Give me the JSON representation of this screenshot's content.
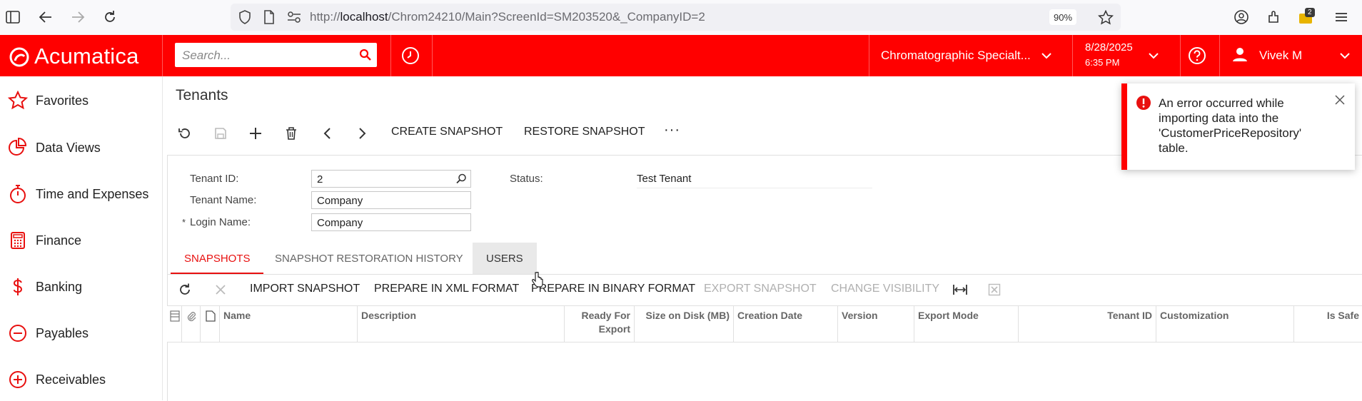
{
  "browser": {
    "url_prefix": "http://",
    "url_host": "localhost",
    "url_path": "/Chrom24210/Main?ScreenId=SM203520&_CompanyID=2",
    "zoom": "90%",
    "extensions_badge": "2"
  },
  "header": {
    "logo": "Acumatica",
    "search_placeholder": "Search...",
    "company": "Chromatographic Specialt...",
    "date": "8/28/2025",
    "time": "6:35 PM",
    "user": "Vivek M"
  },
  "sidebar": {
    "items": [
      {
        "label": "Favorites",
        "icon": "star-icon"
      },
      {
        "label": "Data Views",
        "icon": "pie-chart-icon"
      },
      {
        "label": "Time and Expenses",
        "icon": "stopwatch-icon"
      },
      {
        "label": "Finance",
        "icon": "calculator-icon"
      },
      {
        "label": "Banking",
        "icon": "dollar-icon"
      },
      {
        "label": "Payables",
        "icon": "minus-circle-icon"
      },
      {
        "label": "Receivables",
        "icon": "plus-circle-icon"
      }
    ]
  },
  "page": {
    "title": "Tenants",
    "toolbar": {
      "create_snapshot": "CREATE SNAPSHOT",
      "restore_snapshot": "RESTORE SNAPSHOT",
      "more": "···"
    }
  },
  "form": {
    "tenant_id_label": "Tenant ID:",
    "tenant_id_value": "2",
    "tenant_name_label": "Tenant Name:",
    "tenant_name_value": "Company",
    "login_required": "*",
    "login_name_label": "Login Name:",
    "login_name_value": "Company",
    "status_label": "Status:",
    "status_value": "Test Tenant"
  },
  "tabs": [
    {
      "label": "SNAPSHOTS",
      "active": true
    },
    {
      "label": "SNAPSHOT RESTORATION HISTORY",
      "active": false
    },
    {
      "label": "USERS",
      "active": false
    }
  ],
  "grid_toolbar": {
    "import_snapshot": "IMPORT SNAPSHOT",
    "prepare_xml": "PREPARE IN XML FORMAT",
    "prepare_binary": "PREPARE IN BINARY FORMAT",
    "export_snapshot": "EXPORT SNAPSHOT",
    "change_visibility": "CHANGE VISIBILITY"
  },
  "grid": {
    "columns": {
      "name": "Name",
      "description": "Description",
      "ready_for_export": "Ready For Export",
      "size_on_disk": "Size on Disk (MB)",
      "creation_date": "Creation Date",
      "version": "Version",
      "export_mode": "Export Mode",
      "tenant_id": "Tenant ID",
      "customization": "Customization",
      "is_safe": "Is Safe"
    },
    "rows": []
  },
  "toast": {
    "message": "An error occurred while importing data into the 'CustomerPriceRepository' table."
  },
  "colors": {
    "brand": "#ff0000",
    "active_tab": "#e8100f"
  }
}
